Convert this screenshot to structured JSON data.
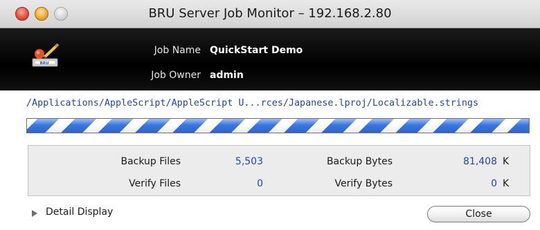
{
  "window": {
    "title": "BRU Server Job Monitor – 192.168.2.80"
  },
  "job": {
    "name_label": "Job Name",
    "name_value": "QuickStart Demo",
    "owner_label": "Job Owner",
    "owner_value": "admin"
  },
  "current_file": "/Applications/AppleScript/AppleScript U...rces/Japanese.lproj/Localizable.strings",
  "progress": {
    "state": "indeterminate",
    "color": "#2f6fe0"
  },
  "stats": {
    "backup_files_label": "Backup Files",
    "backup_files_value": "5,503",
    "backup_bytes_label": "Backup Bytes",
    "backup_bytes_value": "81,408",
    "backup_bytes_unit": "K",
    "verify_files_label": "Verify Files",
    "verify_files_value": "0",
    "verify_bytes_label": "Verify Bytes",
    "verify_bytes_value": "0",
    "verify_bytes_unit": "K"
  },
  "footer": {
    "detail_label": "Detail Display",
    "close_label": "Close"
  },
  "icons": {
    "app": "bru-app-icon",
    "disclosure": "disclosure-triangle-icon"
  },
  "colors": {
    "accent_blue": "#1f46b0",
    "header_bg": "#000000"
  }
}
